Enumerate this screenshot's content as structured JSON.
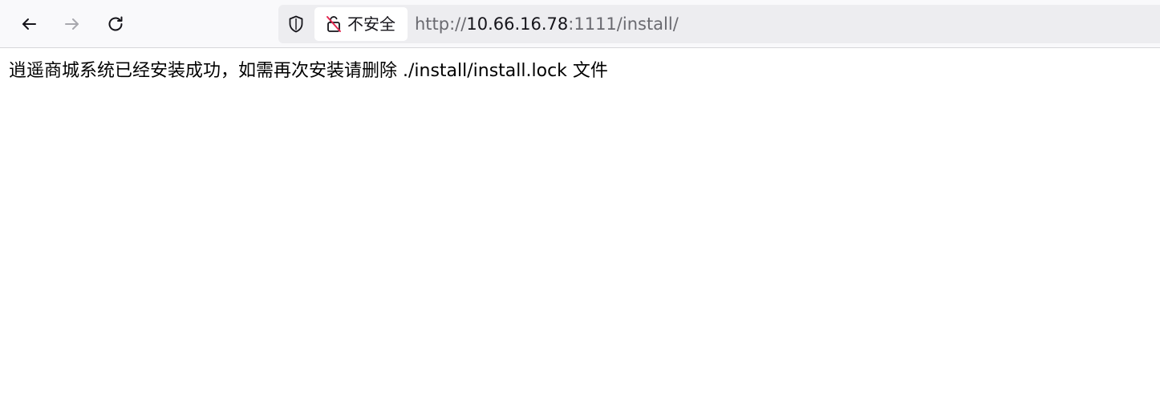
{
  "toolbar": {
    "back_icon": "arrow-left-icon",
    "forward_icon": "arrow-right-icon",
    "reload_icon": "reload-icon"
  },
  "urlbar": {
    "shield_icon": "shield-icon",
    "security_icon": "insecure-lock-icon",
    "security_label": "不安全",
    "url_scheme": "http://",
    "url_host": "10.66.16.78",
    "url_rest": ":1111/install/",
    "colors": {
      "insecure_slash": "#e22850",
      "host_text": "#15141a",
      "dim_text": "#6a6a70"
    }
  },
  "page": {
    "message": "逍遥商城系统已经安装成功，如需再次安装请删除 ./install/install.lock 文件"
  }
}
